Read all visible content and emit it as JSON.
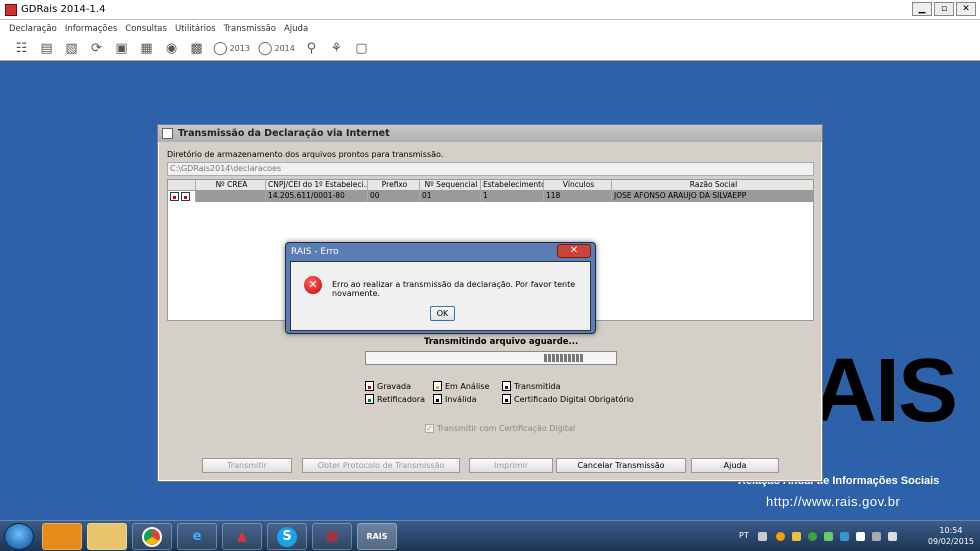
{
  "app": {
    "title": "GDRais 2014-1.4",
    "window_buttons": [
      "▁",
      "▫",
      "✕"
    ],
    "menu": [
      "Declaração",
      "Informações",
      "Consultas",
      "Utilitários",
      "Transmissão",
      "Ajuda"
    ],
    "toolbar": {
      "year_2013": "2013",
      "year_2014": "2014"
    }
  },
  "transmission_dialog": {
    "title": "Transmissão da Declaração via Internet",
    "dir_label": "Diretório de armazenamento dos arquivos prontos para transmissão.",
    "dir_value": "C:\\GDRais2014\\declaracoes",
    "table": {
      "columns": [
        "",
        "Nº CREA",
        "CNPJ/CEI do 1º Estabeleci...",
        "Prefixo",
        "Nº Sequencial",
        "Estabelecimentos",
        "Vínculos",
        "Razão Social"
      ],
      "rows": [
        [
          "",
          "",
          "14.205.611/0001-80",
          "00",
          "01",
          "1",
          "118",
          "JOSE AFONSO ARAUJO DA SILVAEPP"
        ]
      ]
    },
    "status": "Transmitindo arquivo aguarde...",
    "progress_segment": 0.16,
    "legend": {
      "gravada": "Gravada",
      "em_analise": "Em Análise",
      "transmitida": "Transmitida",
      "retificadora": "Retificadora",
      "invalida": "Inválida",
      "cert_obrigatorio": "Certificado Digital Obrigatório"
    },
    "cert_checkbox": "Transmitir com Certificação Digital",
    "cert_checked": true,
    "buttons": {
      "transmitir": "Transmitir",
      "protocolo": "Obter Protocolo de Transmissão",
      "imprimir": "Imprimir",
      "cancelar": "Cancelar Transmissão",
      "ajuda": "Ajuda"
    }
  },
  "error_dialog": {
    "title": "RAIS - Erro",
    "close": "✕",
    "icon": "✕",
    "message": "Erro ao realizar a transmissão da declaração. Por favor tente novamente.",
    "ok": "OK"
  },
  "watermark": {
    "logo": "AIS",
    "subtitle": "Relação Anual de Informações Sociais",
    "url": "http://www.rais.gov.br"
  },
  "taskbar": {
    "apps": [
      "outlook-icon",
      "explorer-icon",
      "chrome-icon",
      "ie-icon",
      "app-icon",
      "skype-icon",
      "app2-icon",
      "rais-icon"
    ],
    "language": "PT",
    "time": "10:54",
    "date": "09/02/2015"
  }
}
